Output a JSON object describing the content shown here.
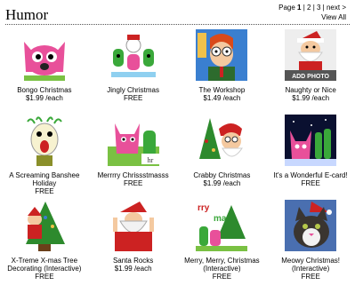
{
  "header": {
    "title": "Humor",
    "pager": {
      "prefix": "Page ",
      "current": "1",
      "sep": " | ",
      "page2": "2",
      "page3": "3",
      "next": "next >"
    },
    "view_all": "View All"
  },
  "cards": [
    {
      "name": "Bongo Christmas",
      "price": "$1.99 /each"
    },
    {
      "name": "Jingly Christmas",
      "price": "FREE"
    },
    {
      "name": "The Workshop",
      "price": "$1.49 /each"
    },
    {
      "name": "Naughty or Nice",
      "price": "$1.99 /each",
      "badge": "ADD PHOTO"
    },
    {
      "name": "A Screaming Banshee Holiday",
      "price": "FREE"
    },
    {
      "name": "Merrrry Chrissstmasss",
      "price": "FREE"
    },
    {
      "name": "Crabby Christmas",
      "price": "$1.99 /each"
    },
    {
      "name": "It's a Wonderful E-card!",
      "price": "FREE"
    },
    {
      "name": "X-Treme X-mas Tree Decorating (Interactive)",
      "price": "FREE"
    },
    {
      "name": "Santa Rocks",
      "price": "$1.99 /each"
    },
    {
      "name": "Merry, Merry, Christmas (Interactive)",
      "price": "FREE"
    },
    {
      "name": "Meowy Christmas! (Interactive)",
      "price": "FREE"
    }
  ],
  "colors": {
    "pink": "#e8509a",
    "green": "#3aa83a",
    "red": "#cc2222",
    "blue": "#3a7fd0"
  }
}
